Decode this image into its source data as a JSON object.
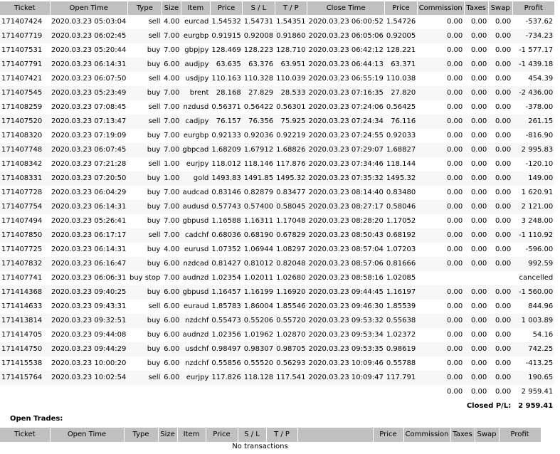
{
  "columns": [
    "Ticket",
    "Open Time",
    "Type",
    "Size",
    "Item",
    "Price",
    "S / L",
    "T / P",
    "Close Time",
    "Price",
    "Commission",
    "Taxes",
    "Swap",
    "Profit"
  ],
  "closed_trades": [
    [
      "171407424",
      "2020.03.23 05:03:04",
      "sell",
      "4.00",
      "eurcad",
      "1.54532",
      "1.54731",
      "1.54351",
      "2020.03.23 06:00:52",
      "1.54726",
      "0.00",
      "0.00",
      "0.00",
      "-537.62"
    ],
    [
      "171407719",
      "2020.03.23 06:02:45",
      "sell",
      "7.00",
      "eurgbp",
      "0.91915",
      "0.92008",
      "0.91860",
      "2020.03.23 06:05:06",
      "0.92005",
      "0.00",
      "0.00",
      "0.00",
      "-734.23"
    ],
    [
      "171407531",
      "2020.03.23 05:20:44",
      "buy",
      "7.00",
      "gbpjpy",
      "128.469",
      "128.223",
      "128.710",
      "2020.03.23 06:42:12",
      "128.221",
      "0.00",
      "0.00",
      "0.00",
      "-1 577.17"
    ],
    [
      "171407791",
      "2020.03.23 06:14:31",
      "buy",
      "6.00",
      "audjpy",
      "63.635",
      "63.376",
      "63.951",
      "2020.03.23 06:44:13",
      "63.371",
      "0.00",
      "0.00",
      "0.00",
      "-1 439.18"
    ],
    [
      "171407421",
      "2020.03.23 06:07:50",
      "sell",
      "4.00",
      "usdjpy",
      "110.163",
      "110.328",
      "110.039",
      "2020.03.23 06:55:19",
      "110.038",
      "0.00",
      "0.00",
      "0.00",
      "454.39"
    ],
    [
      "171407545",
      "2020.03.23 05:23:49",
      "buy",
      "7.00",
      "brent",
      "28.168",
      "27.829",
      "28.533",
      "2020.03.23 07:16:35",
      "27.820",
      "0.00",
      "0.00",
      "0.00",
      "-2 436.00"
    ],
    [
      "171408259",
      "2020.03.23 07:08:45",
      "sell",
      "7.00",
      "nzdusd",
      "0.56371",
      "0.56422",
      "0.56301",
      "2020.03.23 07:24:06",
      "0.56425",
      "0.00",
      "0.00",
      "0.00",
      "-378.00"
    ],
    [
      "171407520",
      "2020.03.23 07:13:47",
      "sell",
      "7.00",
      "cadjpy",
      "76.157",
      "76.356",
      "75.925",
      "2020.03.23 07:24:34",
      "76.116",
      "0.00",
      "0.00",
      "0.00",
      "261.15"
    ],
    [
      "171408320",
      "2020.03.23 07:19:09",
      "buy",
      "7.00",
      "eurgbp",
      "0.92133",
      "0.92036",
      "0.92219",
      "2020.03.23 07:24:55",
      "0.92033",
      "0.00",
      "0.00",
      "0.00",
      "-816.90"
    ],
    [
      "171407748",
      "2020.03.23 06:07:45",
      "buy",
      "7.00",
      "gbpcad",
      "1.68209",
      "1.67912",
      "1.68826",
      "2020.03.23 07:29:07",
      "1.68827",
      "0.00",
      "0.00",
      "0.00",
      "2 995.83"
    ],
    [
      "171408342",
      "2020.03.23 07:21:28",
      "sell",
      "1.00",
      "eurjpy",
      "118.012",
      "118.146",
      "117.876",
      "2020.03.23 07:34:46",
      "118.144",
      "0.00",
      "0.00",
      "0.00",
      "-120.10"
    ],
    [
      "171408331",
      "2020.03.23 07:20:50",
      "buy",
      "1.00",
      "gold",
      "1493.83",
      "1491.85",
      "1495.32",
      "2020.03.23 07:35:32",
      "1495.32",
      "0.00",
      "0.00",
      "0.00",
      "149.00"
    ],
    [
      "171407728",
      "2020.03.23 06:04:29",
      "buy",
      "7.00",
      "audcad",
      "0.83146",
      "0.82879",
      "0.83477",
      "2020.03.23 08:14:40",
      "0.83480",
      "0.00",
      "0.00",
      "0.00",
      "1 620.91"
    ],
    [
      "171407754",
      "2020.03.23 06:14:31",
      "buy",
      "7.00",
      "audusd",
      "0.57743",
      "0.57400",
      "0.58045",
      "2020.03.23 08:27:17",
      "0.58046",
      "0.00",
      "0.00",
      "0.00",
      "2 121.00"
    ],
    [
      "171407494",
      "2020.03.23 05:26:41",
      "buy",
      "7.00",
      "gbpusd",
      "1.16588",
      "1.16311",
      "1.17048",
      "2020.03.23 08:28:20",
      "1.17052",
      "0.00",
      "0.00",
      "0.00",
      "3 248.00"
    ],
    [
      "171407850",
      "2020.03.23 06:17:17",
      "sell",
      "7.00",
      "cadchf",
      "0.68036",
      "0.68190",
      "0.67829",
      "2020.03.23 08:50:43",
      "0.68192",
      "0.00",
      "0.00",
      "0.00",
      "-1 110.92"
    ],
    [
      "171407725",
      "2020.03.23 06:14:31",
      "buy",
      "4.00",
      "eurusd",
      "1.07352",
      "1.06944",
      "1.08297",
      "2020.03.23 08:57:04",
      "1.07203",
      "0.00",
      "0.00",
      "0.00",
      "-596.00"
    ],
    [
      "171407832",
      "2020.03.23 06:16:47",
      "buy",
      "6.00",
      "nzdcad",
      "0.81427",
      "0.81012",
      "0.82048",
      "2020.03.23 08:57:06",
      "0.81666",
      "0.00",
      "0.00",
      "0.00",
      "992.59"
    ],
    [
      "171407741",
      "2020.03.23 06:06:31",
      "buy stop",
      "7.00",
      "audnzd",
      "1.02354",
      "1.02011",
      "1.02680",
      "2020.03.23 08:58:16",
      "1.02085",
      "",
      "",
      "",
      "cancelled"
    ],
    [
      "171414368",
      "2020.03.23 09:40:25",
      "buy",
      "6.00",
      "gbpusd",
      "1.16457",
      "1.16199",
      "1.16920",
      "2020.03.23 09:44:45",
      "1.16197",
      "0.00",
      "0.00",
      "0.00",
      "-1 560.00"
    ],
    [
      "171414633",
      "2020.03.23 09:43:31",
      "sell",
      "6.00",
      "euraud",
      "1.85783",
      "1.86004",
      "1.85546",
      "2020.03.23 09:46:30",
      "1.85539",
      "0.00",
      "0.00",
      "0.00",
      "844.96"
    ],
    [
      "171413814",
      "2020.03.23 09:32:51",
      "buy",
      "6.00",
      "nzdchf",
      "0.55473",
      "0.55206",
      "0.55720",
      "2020.03.23 09:53:32",
      "0.55638",
      "0.00",
      "0.00",
      "0.00",
      "1 003.89"
    ],
    [
      "171414705",
      "2020.03.23 09:44:08",
      "buy",
      "6.00",
      "audnzd",
      "1.02356",
      "1.01962",
      "1.02870",
      "2020.03.23 09:53:34",
      "1.02372",
      "0.00",
      "0.00",
      "0.00",
      "54.16"
    ],
    [
      "171414750",
      "2020.03.23 09:44:29",
      "buy",
      "6.00",
      "usdchf",
      "0.98497",
      "0.98307",
      "0.98705",
      "2020.03.23 09:53:35",
      "0.98619",
      "0.00",
      "0.00",
      "0.00",
      "742.25"
    ],
    [
      "171415538",
      "2020.03.23 10:00:20",
      "buy",
      "6.00",
      "nzdchf",
      "0.55856",
      "0.55520",
      "0.56293",
      "2020.03.23 10:09:46",
      "0.55788",
      "0.00",
      "0.00",
      "0.00",
      "-413.25"
    ],
    [
      "171415764",
      "2020.03.23 10:02:54",
      "sell",
      "6.00",
      "eurjpy",
      "117.826",
      "118.128",
      "117.541",
      "2020.03.23 10:09:47",
      "117.791",
      "0.00",
      "0.00",
      "0.00",
      "190.65"
    ]
  ],
  "totals": {
    "commission": "0.00",
    "taxes": "0.00",
    "swap": "0.00",
    "profit": "2 959.41"
  },
  "closed_pl": {
    "label": "Closed P/L:",
    "value": "2 959.41"
  },
  "open_trades": {
    "title": "Open Trades:",
    "empty_message": "No transactions"
  }
}
